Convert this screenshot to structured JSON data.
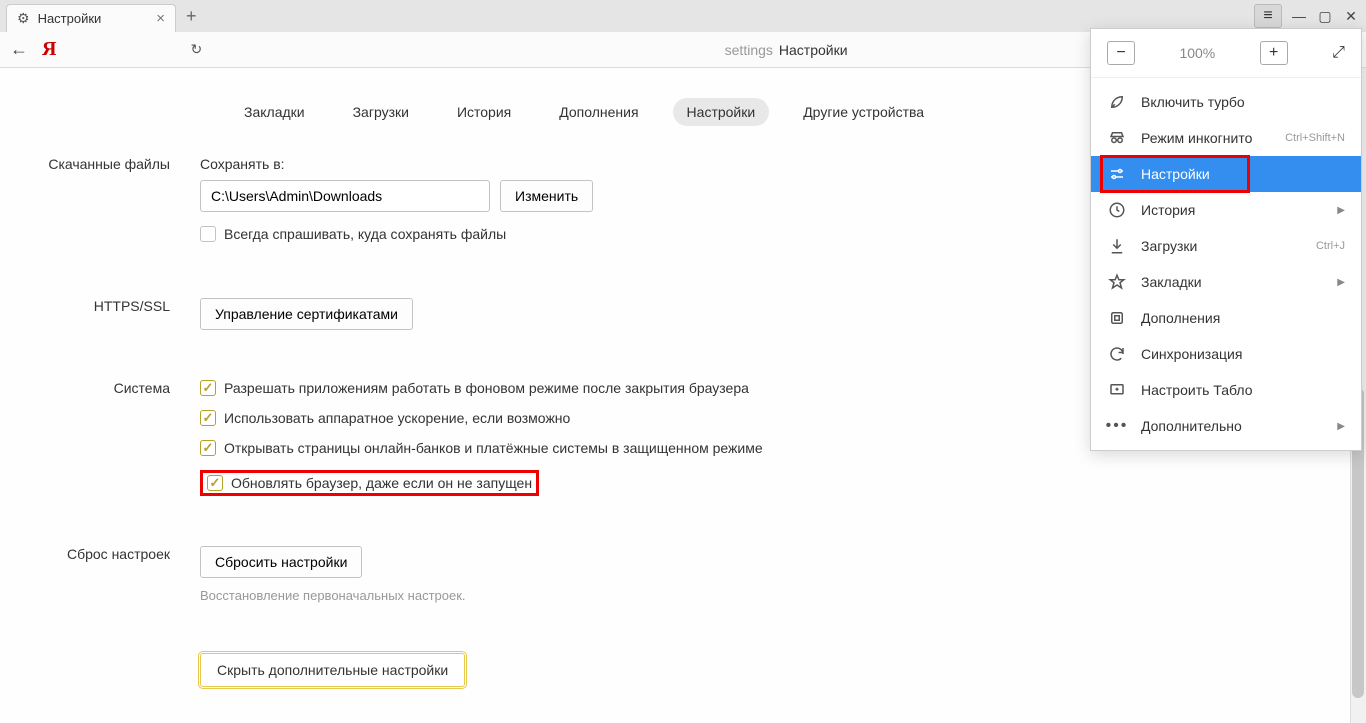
{
  "tab": {
    "title": "Настройки"
  },
  "address": {
    "prefix": "settings",
    "title": "Настройки"
  },
  "zoom": {
    "value": "100%"
  },
  "nav": {
    "items": [
      "Закладки",
      "Загрузки",
      "История",
      "Дополнения",
      "Настройки",
      "Другие устройства"
    ],
    "active_index": 4
  },
  "downloads": {
    "section": "Скачанные файлы",
    "save_label": "Сохранять в:",
    "path": "C:\\Users\\Admin\\Downloads",
    "change": "Изменить",
    "ask": "Всегда спрашивать, куда сохранять файлы"
  },
  "https": {
    "section": "HTTPS/SSL",
    "manage": "Управление сертификатами"
  },
  "system": {
    "section": "Система",
    "opts": [
      "Разрешать приложениям работать в фоновом режиме после закрытия браузера",
      "Использовать аппаратное ускорение, если возможно",
      "Открывать страницы онлайн-банков и платёжные системы в защищенном режиме",
      "Обновлять браузер, даже если он не запущен"
    ]
  },
  "reset": {
    "section": "Сброс настроек",
    "btn": "Сбросить настройки",
    "help": "Восстановление первоначальных настроек."
  },
  "hide_advanced": "Скрыть дополнительные настройки",
  "menu": {
    "items": [
      {
        "icon": "rocket",
        "label": "Включить турбо",
        "shortcut": "",
        "arrow": false,
        "selected": false
      },
      {
        "icon": "incognito",
        "label": "Режим инкогнито",
        "shortcut": "Ctrl+Shift+N",
        "arrow": false,
        "selected": false
      },
      {
        "icon": "sliders",
        "label": "Настройки",
        "shortcut": "",
        "arrow": false,
        "selected": true
      },
      {
        "icon": "history",
        "label": "История",
        "shortcut": "",
        "arrow": true,
        "selected": false
      },
      {
        "icon": "download",
        "label": "Загрузки",
        "shortcut": "Ctrl+J",
        "arrow": false,
        "selected": false
      },
      {
        "icon": "star",
        "label": "Закладки",
        "shortcut": "",
        "arrow": true,
        "selected": false
      },
      {
        "icon": "puzzle",
        "label": "Дополнения",
        "shortcut": "",
        "arrow": false,
        "selected": false
      },
      {
        "icon": "sync",
        "label": "Синхронизация",
        "shortcut": "",
        "arrow": false,
        "selected": false
      },
      {
        "icon": "tablo",
        "label": "Настроить Табло",
        "shortcut": "",
        "arrow": false,
        "selected": false
      },
      {
        "icon": "more",
        "label": "Дополнительно",
        "shortcut": "",
        "arrow": true,
        "selected": false
      }
    ]
  }
}
